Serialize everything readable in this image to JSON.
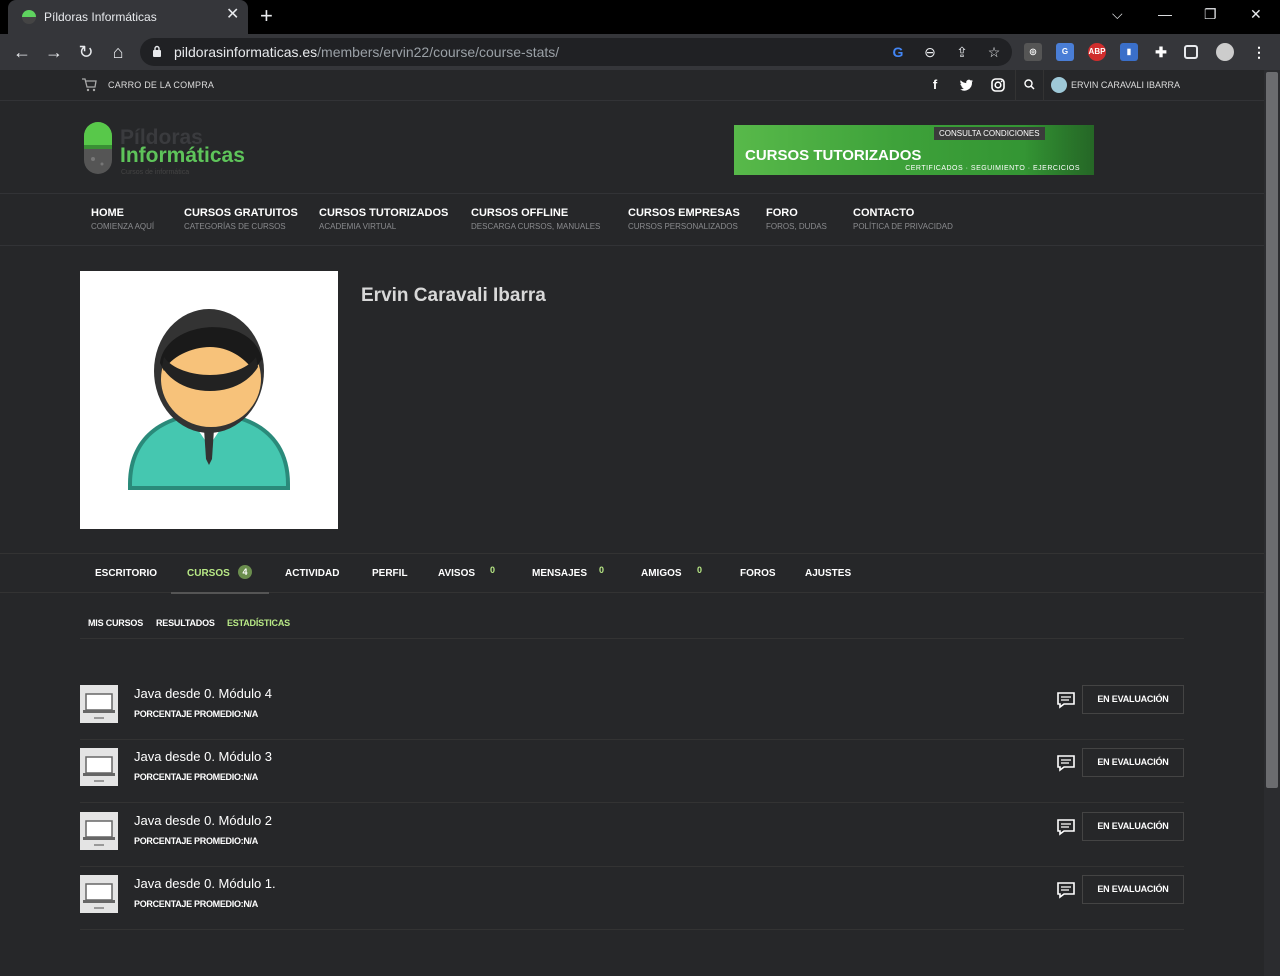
{
  "browser": {
    "tab_title": "Píldoras Informáticas",
    "url_host": "pildorasinformaticas.es",
    "url_path": "/members/ervin22/course/course-stats/",
    "extensions": [
      "glasses-icon",
      "translate-icon",
      "abp-icon",
      "reader-icon",
      "puzzle-icon",
      "sidepanel-icon",
      "profile-icon"
    ],
    "abp_label": "ABP"
  },
  "topbar": {
    "cart_label": "CARRO DE LA COMPRA",
    "user_label": "ERVIN CARAVALI IBARRA",
    "facebook": "f",
    "twitter": "t",
    "instagram": "◎"
  },
  "logo": {
    "line1": "Píldoras",
    "line2": "Informáticas",
    "tagline": "Cursos de informática"
  },
  "banner": {
    "tag": "CONSULTA CONDICIONES",
    "title": "CURSOS TUTORIZADOS",
    "subtitle": "CERTIFICADOS · SEGUIMIENTO · EJERCICIOS"
  },
  "nav": [
    {
      "title": "HOME",
      "sub": "COMIENZA AQUÍ"
    },
    {
      "title": "CURSOS GRATUITOS",
      "sub": "CATEGORÍAS DE CURSOS"
    },
    {
      "title": "CURSOS TUTORIZADOS",
      "sub": "ACADEMIA VIRTUAL"
    },
    {
      "title": "CURSOS OFFLINE",
      "sub": "DESCARGA CURSOS, MANUALES"
    },
    {
      "title": "CURSOS EMPRESAS",
      "sub": "CURSOS PERSONALIZADOS"
    },
    {
      "title": "FORO",
      "sub": "FOROS, DUDAS"
    },
    {
      "title": "CONTACTO",
      "sub": "POLÍTICA DE PRIVACIDAD"
    }
  ],
  "profile": {
    "name": "Ervin Caravali Ibarra"
  },
  "member_nav": [
    {
      "label": "ESCRITORIO"
    },
    {
      "label": "CURSOS",
      "count": "4"
    },
    {
      "label": "ACTIVIDAD"
    },
    {
      "label": "PERFIL"
    },
    {
      "label": "AVISOS",
      "count": "0"
    },
    {
      "label": "MENSAJES",
      "count": "0"
    },
    {
      "label": "AMIGOS",
      "count": "0"
    },
    {
      "label": "FOROS"
    },
    {
      "label": "AJUSTES"
    }
  ],
  "course_tabs": [
    {
      "label": "MIS CURSOS"
    },
    {
      "label": "RESULTADOS"
    },
    {
      "label": "ESTADÍSTICAS"
    }
  ],
  "courses": [
    {
      "title": "Java desde 0. Módulo 4",
      "meta": "PORCENTAJE PROMEDIO:N/A",
      "status": "EN EVALUACIÓN"
    },
    {
      "title": "Java desde 0. Módulo 3",
      "meta": "PORCENTAJE PROMEDIO:N/A",
      "status": "EN EVALUACIÓN"
    },
    {
      "title": "Java desde 0. Módulo 2",
      "meta": "PORCENTAJE PROMEDIO:N/A",
      "status": "EN EVALUACIÓN"
    },
    {
      "title": "Java desde 0. Módulo 1.",
      "meta": "PORCENTAJE PROMEDIO:N/A",
      "status": "EN EVALUACIÓN"
    }
  ],
  "colors": {
    "accent_green": "#b8e986",
    "logo_green": "#5ec45a",
    "background": "#262729"
  }
}
